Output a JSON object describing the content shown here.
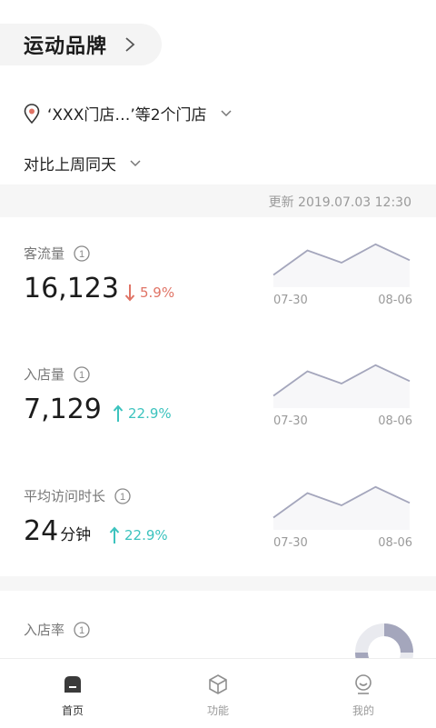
{
  "header": {
    "brand_title": "运动品牌"
  },
  "store_selector": {
    "text": "‘XXX门店…’等2个门店"
  },
  "compare_selector": {
    "text": "对比上周同天"
  },
  "update": {
    "text": "更新 2019.07.03 12:30"
  },
  "metrics": [
    {
      "label": "客流量",
      "value": "16,123",
      "unit": "",
      "change": "5.9%",
      "direction": "down",
      "chart_data": {
        "type": "area",
        "x": [
          "07-30",
          "",
          "",
          "",
          "08-06"
        ],
        "values": [
          1,
          3,
          2,
          3.5,
          2.2
        ],
        "x_ticks": [
          "07-30",
          "08-06"
        ]
      }
    },
    {
      "label": "入店量",
      "value": "7,129",
      "unit": "",
      "change": "22.9%",
      "direction": "up",
      "chart_data": {
        "type": "area",
        "x": [
          "07-30",
          "",
          "",
          "",
          "08-06"
        ],
        "values": [
          1,
          3,
          2,
          3.5,
          2.2
        ],
        "x_ticks": [
          "07-30",
          "08-06"
        ]
      }
    },
    {
      "label": "平均访问时长",
      "value": "24",
      "unit": "分钟",
      "change": "22.9%",
      "direction": "up",
      "chart_data": {
        "type": "area",
        "x": [
          "07-30",
          "",
          "",
          "",
          "08-06"
        ],
        "values": [
          1,
          3,
          2,
          3.5,
          2.2
        ],
        "x_ticks": [
          "07-30",
          "08-06"
        ]
      }
    }
  ],
  "entry_rate": {
    "label": "入店率"
  },
  "nav": [
    {
      "label": "首页",
      "icon": "home-icon",
      "active": true
    },
    {
      "label": "功能",
      "icon": "cube-icon",
      "active": false
    },
    {
      "label": "我的",
      "icon": "profile-icon",
      "active": false
    }
  ],
  "colors": {
    "accent_up": "#3cc3be",
    "accent_down": "#e07466",
    "line": "#a4a6bc"
  }
}
